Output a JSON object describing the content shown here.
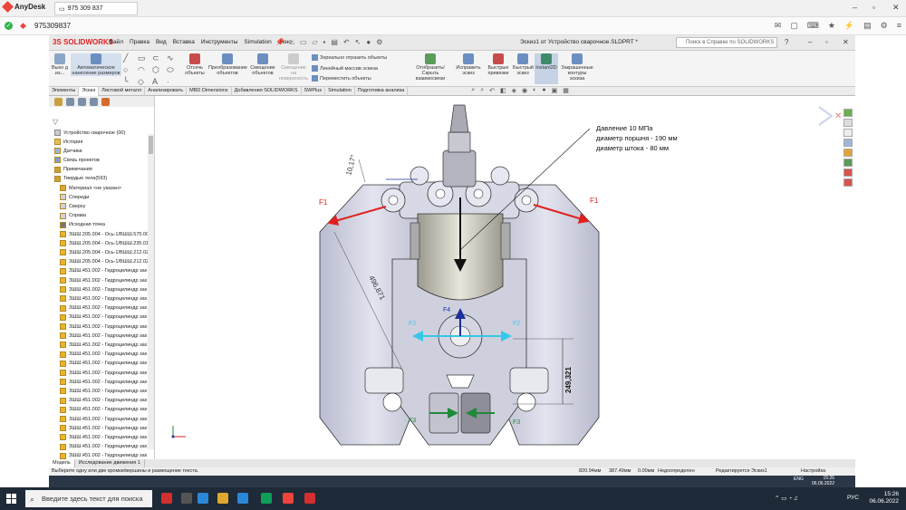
{
  "anydesk": {
    "app_name": "AnyDesk",
    "tab_label": "975 309 837",
    "session_id": "975309837"
  },
  "solidworks": {
    "logo": "3S SOLIDWORKS",
    "menu": [
      "Файл",
      "Правка",
      "Вид",
      "Вставка",
      "Инструменты",
      "Simulation",
      "Окно"
    ],
    "document_title": "Эскиз1 от Устройство сварочное.SLDPRT *",
    "search_placeholder": "Поиск в Справке по SOLIDWORKS"
  },
  "ribbon": {
    "exit_sketch": "Выхо д из...",
    "auto_dims": "Автоматическое нанесение размеров",
    "trim": "Отсечь объекты",
    "convert": "Преобразование объектов",
    "offset": "Смещение объектов",
    "offset_surface": "Смещение на поверхность",
    "mirror": "Зеркально отразить объекты",
    "linear_pattern": "Линейный массив эскиза",
    "move": "Переместить объекты",
    "show_hide": "Отобразить/Скрыть взаимосвязи",
    "repair": "Исправить эскиз",
    "quick_snaps": "Быстрые привязки",
    "rapid_sketch": "Быстрый эскиз",
    "instant2d": "Instant2D",
    "shaded": "Закрашенные контуры эскиза"
  },
  "tabs": [
    "Элементы",
    "Эскиз",
    "Листовой металл",
    "Анализировать",
    "MBD Dimensions",
    "Добавления SOLIDWORKS",
    "SWPlus",
    "Simulation",
    "Подготовка анализа"
  ],
  "active_tab": "Эскиз",
  "tree": {
    "root": "Устройство сварочное (00)",
    "items": [
      "История",
      "Датчики",
      "Связь проектов",
      "Примечания",
      "Твердые тела(593)",
      "Материал <не указан>",
      "Спереди",
      "Сверху",
      "Справа",
      "Исходная точка",
      "ЗШШ.205.004 - Ось-1/ВШШ.575.00",
      "ЗШШ.205.004 - Ось-1/ВШШ.235.01",
      "ЗШШ.205.004 - Ось-1/ВШШ.212.02",
      "ЗШШ.205.004 - Ось-1/ВШШ.212.02",
      "ЗШШ.451.002 - Гидроцилиндр зах",
      "ЗШШ.451.002 - Гидроцилиндр зах",
      "ЗШШ.451.002 - Гидроцилиндр зах",
      "ЗШШ.451.002 - Гидроцилиндр зах",
      "ЗШШ.451.002 - Гидроцилиндр зах",
      "ЗШШ.451.002 - Гидроцилиндр зах",
      "ЗШШ.451.002 - Гидроцилиндр зах",
      "ЗШШ.451.002 - Гидроцилиндр зах",
      "ЗШШ.451.002 - Гидроцилиндр зах",
      "ЗШШ.451.002 - Гидроцилиндр зах",
      "ЗШШ.451.002 - Гидроцилиндр зах",
      "ЗШШ.451.002 - Гидроцилиндр зах",
      "ЗШШ.451.002 - Гидроцилиндр зах",
      "ЗШШ.451.002 - Гидроцилиндр зах",
      "ЗШШ.451.002 - Гидроцилиндр зах",
      "ЗШШ.451.002 - Гидроцилиндр зах",
      "ЗШШ.451.002 - Гидроцилиндр зах",
      "ЗШШ.451.002 - Гидроцилиндр зах",
      "ЗШШ.451.002 - Гидроцилиндр зах",
      "ЗШШ.451.002 - Гидроцилиндр зах",
      "ЗШШ.451.002 - Гидроцилиндр зах",
      "ЗШШ.451.002 - Гидроцилиндр зах",
      "ЗШШ.451.002 - Гидроцилиндр зах"
    ]
  },
  "annotation": {
    "line1": "Давление 10 МПа",
    "line2": "диаметр поршня - 190 мм",
    "line3": "диаметр штока - 80 мм",
    "dim_angle": "10,17°",
    "dim_len": "496,871",
    "dim_height": "249,321",
    "f1": "F1",
    "f2": "F2",
    "f3": "F3",
    "f4": "F4"
  },
  "bottom_tabs": [
    "Модель",
    "Исследование движения 1"
  ],
  "status": {
    "hint": "Выберите одну или две кромки/вершины и размещение текста.",
    "x": "820.94мм",
    "y": "387.49мм",
    "z": "0.00мм",
    "state": "Недоопределен",
    "editing": "Редактируется Эскиз1",
    "settings": "Настройка"
  },
  "remote_clock": {
    "time": "15:26",
    "date": "06.06.2022"
  },
  "taskbar": {
    "search_placeholder": "Введите здесь текст для поиска",
    "lang": "РУС",
    "time": "15:26",
    "date": "06.06.2022",
    "lang2": "ENG"
  }
}
